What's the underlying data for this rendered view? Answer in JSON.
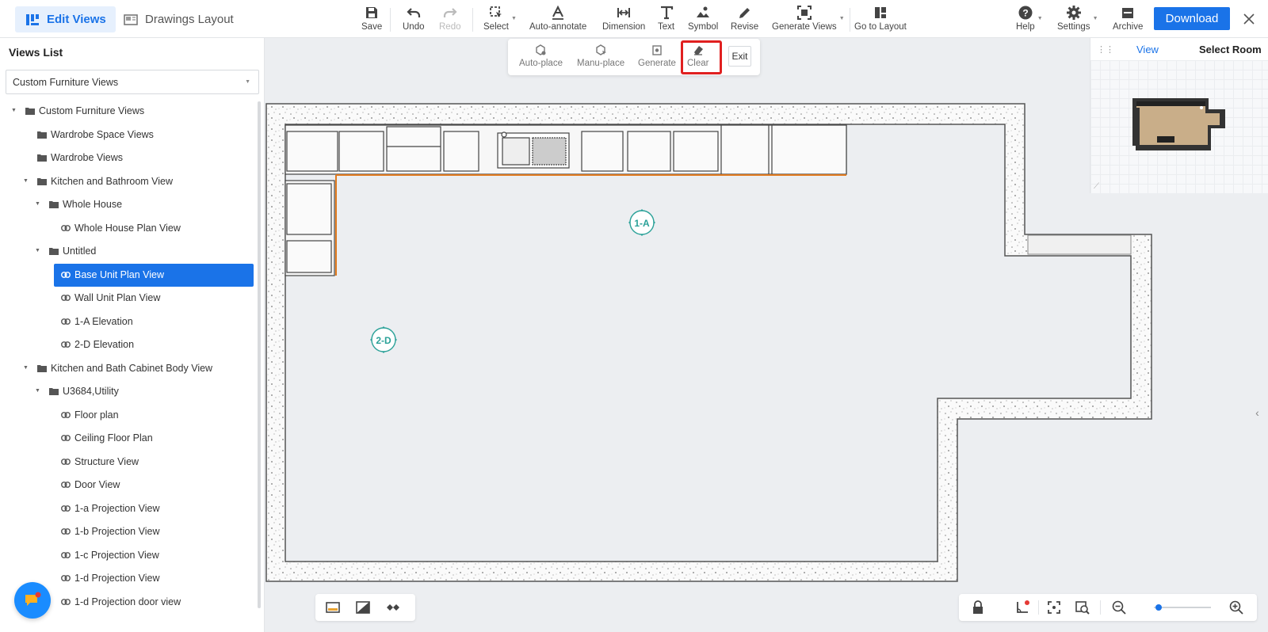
{
  "header": {
    "mode_tabs": [
      {
        "label": "Edit Views",
        "icon": "edit-views-icon",
        "active": true
      },
      {
        "label": "Drawings Layout",
        "icon": "drawings-layout-icon",
        "active": false
      }
    ],
    "tools": {
      "save": "Save",
      "undo": "Undo",
      "redo": "Redo",
      "select": "Select",
      "auto_annotate": "Auto-annotate",
      "dimension": "Dimension",
      "text": "Text",
      "symbol": "Symbol",
      "revise": "Revise",
      "generate_views": "Generate Views",
      "go_to_layout": "Go to Layout",
      "help": "Help",
      "settings": "Settings",
      "archive": "Archive"
    },
    "download_label": "Download",
    "accent_color": "#1a73e8"
  },
  "sidebar": {
    "title": "Views List",
    "selected_view": "Custom Furniture Views",
    "tree": [
      {
        "label": "Custom Furniture Views",
        "type": "folder",
        "expanded": true
      },
      {
        "label": "Wardrobe Space Views",
        "type": "folder"
      },
      {
        "label": "Wardrobe Views",
        "type": "folder"
      },
      {
        "label": "Kitchen and Bathroom View",
        "type": "folder",
        "expanded": true
      },
      {
        "label": "Whole House",
        "type": "folder",
        "expanded": true
      },
      {
        "label": "Whole House Plan View",
        "type": "view"
      },
      {
        "label": "Untitled",
        "type": "folder",
        "expanded": true
      },
      {
        "label": "Base Unit Plan View",
        "type": "view",
        "selected": true
      },
      {
        "label": "Wall Unit Plan View",
        "type": "view"
      },
      {
        "label": "1-A Elevation",
        "type": "view"
      },
      {
        "label": "2-D Elevation",
        "type": "view"
      },
      {
        "label": "Kitchen and Bath Cabinet Body View",
        "type": "folder",
        "expanded": true
      },
      {
        "label": "U3684,Utility",
        "type": "folder",
        "expanded": true
      },
      {
        "label": "Floor plan",
        "type": "view"
      },
      {
        "label": "Ceiling Floor Plan",
        "type": "view"
      },
      {
        "label": "Structure View",
        "type": "view"
      },
      {
        "label": "Door View",
        "type": "view"
      },
      {
        "label": "1-a Projection View",
        "type": "view"
      },
      {
        "label": "1-b Projection View",
        "type": "view"
      },
      {
        "label": "1-c Projection View",
        "type": "view"
      },
      {
        "label": "1-d Projection View",
        "type": "view"
      },
      {
        "label": "1-d Projection door view",
        "type": "view"
      }
    ]
  },
  "subtoolbar": {
    "auto_place": "Auto-place",
    "manu_place": "Manu-place",
    "generate": "Generate",
    "clear": "Clear",
    "exit": "Exit"
  },
  "canvas": {
    "markers": [
      {
        "label": "1-A"
      },
      {
        "label": "2-D"
      }
    ]
  },
  "minimap": {
    "tabs": [
      "View",
      "Select Room"
    ],
    "active_tab": "View"
  },
  "zoom": {
    "level_fraction": 0.05
  }
}
